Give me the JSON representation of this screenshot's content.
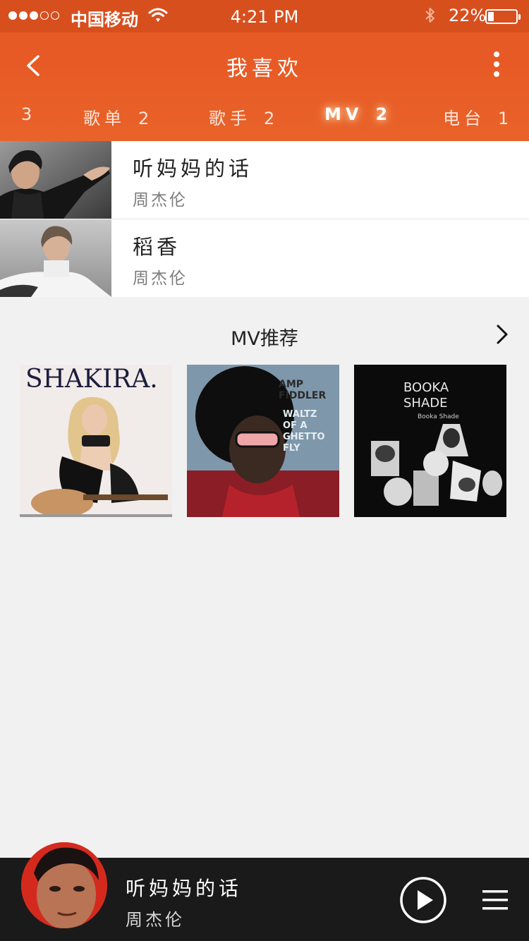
{
  "status_bar": {
    "carrier": "中国移动",
    "time": "4:21 PM",
    "battery": "22%",
    "signal_bars": 3,
    "signal_total": 5,
    "battery_level": 0.22
  },
  "header": {
    "title": "我喜欢",
    "back_icon": "chevron-left-icon",
    "more_icon": "more-vertical-icon"
  },
  "tabs": [
    {
      "label": "",
      "count": "3"
    },
    {
      "label": "歌单",
      "count": "2"
    },
    {
      "label": "歌手",
      "count": "2"
    },
    {
      "label": "MV",
      "count": "2",
      "active": true
    },
    {
      "label": "电台",
      "count": "1"
    }
  ],
  "liked_mvs": [
    {
      "title": "听妈妈的话",
      "artist": "周杰伦"
    },
    {
      "title": "稻香",
      "artist": "周杰伦"
    }
  ],
  "recommend": {
    "title": "MV推荐",
    "more_icon": "chevron-right-icon",
    "covers": [
      {
        "name": "shakira-cover",
        "text": "SHAKIRA."
      },
      {
        "name": "amp-fiddler-cover",
        "text_lines": [
          "AMP",
          "FIDDLER",
          "WALTZ",
          "OF A",
          "GHETTO",
          "FLY"
        ]
      },
      {
        "name": "booka-shade-cover",
        "text_lines": [
          "BOOKA",
          "SHADE",
          "Booka Shade"
        ]
      }
    ]
  },
  "player": {
    "title": "听妈妈的话",
    "artist": "周杰伦",
    "play_icon": "play-icon",
    "playlist_icon": "playlist-icon"
  },
  "colors": {
    "brand_orange": "#e85a25",
    "status_bar": "#d84f1e",
    "background": "#f1f1f1",
    "player_bg": "#1a1a1a"
  }
}
